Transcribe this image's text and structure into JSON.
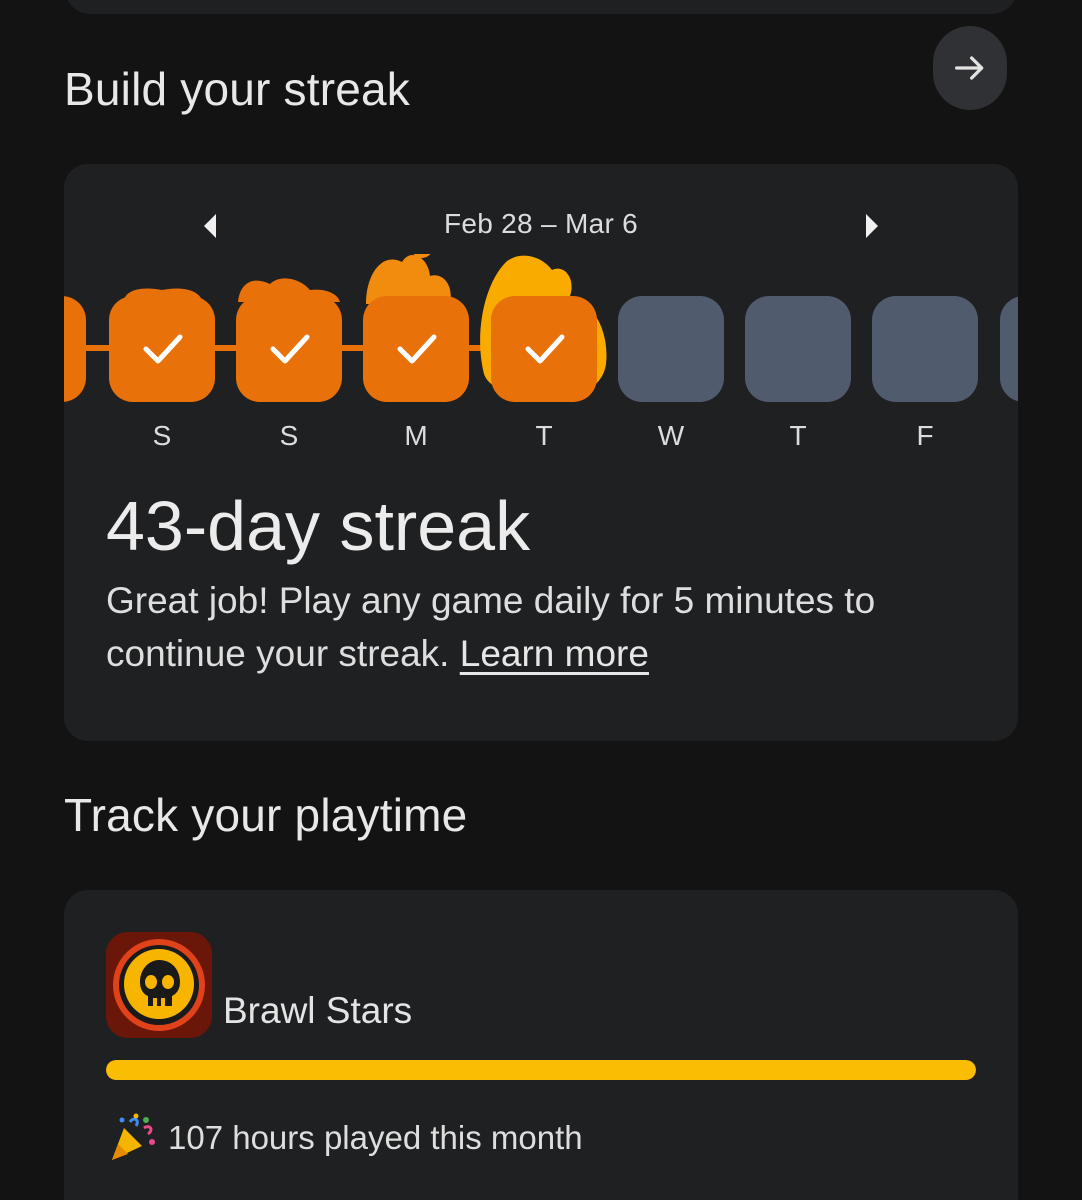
{
  "streak_section": {
    "title": "Build your streak",
    "arrow_icon": "arrow-right-icon",
    "week_range": "Feb 28 – Mar 6",
    "prev_icon": "triangle-left-icon",
    "next_icon": "triangle-right-icon",
    "days": [
      {
        "label": "S",
        "completed": true
      },
      {
        "label": "S",
        "completed": true
      },
      {
        "label": "M",
        "completed": true
      },
      {
        "label": "T",
        "completed": true
      },
      {
        "label": "W",
        "completed": false
      },
      {
        "label": "T",
        "completed": false
      },
      {
        "label": "F",
        "completed": false
      }
    ],
    "streak_count": "43-day streak",
    "description": "Great job! Play any game daily for 5 minutes to continue your streak.",
    "learn_more": "Learn more"
  },
  "playtime_section": {
    "title": "Track your playtime",
    "game_name": "Brawl Stars",
    "progress_fraction": 1.0,
    "played_text": "107 hours played this month",
    "party_icon": "party-popper-icon"
  },
  "colors": {
    "background": "#131314",
    "card": "#1f2022",
    "streak_orange": "#e8710a",
    "flame_orange": "#f28c0e",
    "flame_yellow": "#f9ab00",
    "inactive_day": "#515b6e",
    "progress_yellow": "#fbbc04"
  }
}
